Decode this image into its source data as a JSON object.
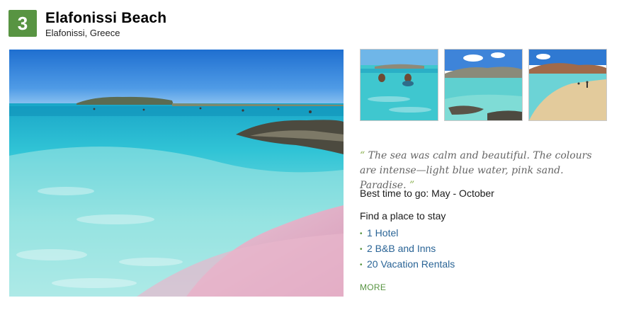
{
  "listing": {
    "rank": "3",
    "title": "Elafonissi Beach",
    "location": "Elafonissi, Greece"
  },
  "photos": {
    "main": "beach-photo",
    "thumbnails": [
      "swimmers-photo",
      "coast-photo",
      "sandbar-photo"
    ]
  },
  "quote": {
    "open_mark": "“",
    "text": "The sea was calm and beautiful. The colours are intense—light blue water, pink sand. Paradise.",
    "close_mark": "”"
  },
  "best_time": "Best time to go: May - October",
  "stay": {
    "heading": "Find a place to stay",
    "bullet": "•",
    "items": [
      "1 Hotel",
      "2 B&B and Inns",
      "20 Vacation Rentals"
    ]
  },
  "more_label": "MORE",
  "colors": {
    "badge_green": "#589442",
    "link_blue": "#2a6496",
    "quote_gray": "#656565"
  }
}
